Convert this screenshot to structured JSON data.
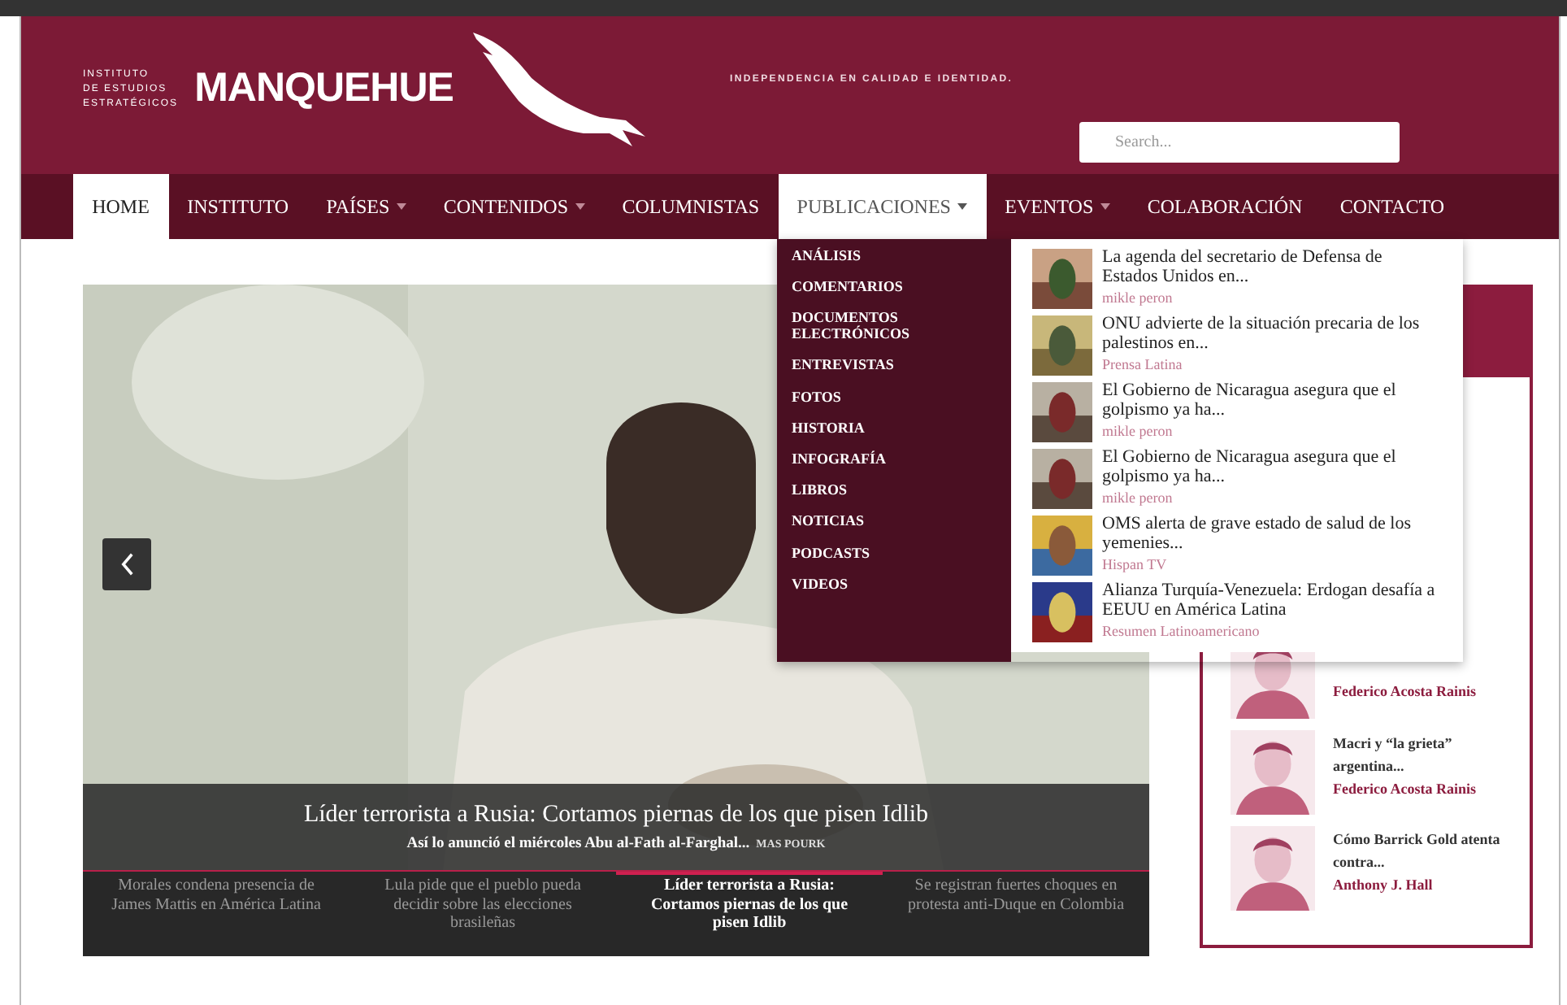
{
  "header": {
    "institute_lines": [
      "INSTITUTO",
      "DE ESTUDIOS",
      "ESTRATÉGICOS"
    ],
    "logo": "MANQUEHUE",
    "tagline": "INDEPENDENCIA EN CALIDAD E IDENTIDAD.",
    "search": {
      "placeholder": "Search..."
    }
  },
  "nav": [
    {
      "label": "HOME",
      "selected": true,
      "open": false,
      "dropdown": false
    },
    {
      "label": "INSTITUTO",
      "selected": false,
      "open": false,
      "dropdown": false
    },
    {
      "label": "PAÍSES",
      "selected": false,
      "open": false,
      "dropdown": true
    },
    {
      "label": "CONTENIDOS",
      "selected": false,
      "open": false,
      "dropdown": true
    },
    {
      "label": "COLUMNISTAS",
      "selected": false,
      "open": false,
      "dropdown": false
    },
    {
      "label": "PUBLICACIONES",
      "selected": false,
      "open": true,
      "dropdown": true
    },
    {
      "label": "EVENTOS",
      "selected": false,
      "open": false,
      "dropdown": true
    },
    {
      "label": "COLABORACIÓN",
      "selected": false,
      "open": false,
      "dropdown": false
    },
    {
      "label": "CONTACTO",
      "selected": false,
      "open": false,
      "dropdown": false
    }
  ],
  "dropdown": {
    "categories": [
      "ANÁLISIS",
      "COMENTARIOS",
      "DOCUMENTOS ELECTRÓNICOS",
      "ENTREVISTAS",
      "FOTOS",
      "HISTORIA",
      "INFOGRAFÍA",
      "LIBROS",
      "NOTICIAS",
      "PODCASTS",
      "VIDEOS"
    ],
    "news": [
      {
        "title": "La agenda del secretario de Defensa de Estados Unidos en...",
        "source": "mikle peron"
      },
      {
        "title": "ONU advierte de la situación precaria de los palestinos en...",
        "source": "Prensa Latina"
      },
      {
        "title": "El Gobierno de Nicaragua asegura que el golpismo ya ha...",
        "source": "mikle peron"
      },
      {
        "title": "El Gobierno de Nicaragua asegura que el golpismo ya ha...",
        "source": "mikle peron"
      },
      {
        "title": "OMS alerta de grave estado de salud de los yemenies...",
        "source": "Hispan TV"
      },
      {
        "title": "Alianza Turquía-Venezuela: Erdogan desafía a EEUU en América Latina",
        "source": "Resumen Latinoamericano"
      }
    ]
  },
  "slider": {
    "title": "Líder terrorista a Rusia: Cortamos piernas de los que pisen Idlib",
    "summary": "Así lo anunció el miércoles Abu al-Fath al-Farghal...",
    "more": "MAS POURK",
    "thumbs": [
      {
        "text": "Morales condena presencia de James Mattis en América Latina",
        "selected": false
      },
      {
        "text": "Lula pide que el pueblo pueda decidir sobre las elecciones brasileñas",
        "selected": false
      },
      {
        "text": "Líder terrorista a Rusia: Cortamos piernas de los que pisen Idlib",
        "selected": true
      },
      {
        "text": "Se registran fuertes choques en protesta anti-Duque en Colombia",
        "selected": false
      }
    ]
  },
  "sidebar": {
    "items": [
      {
        "author": "Federico Acosta Rainis"
      },
      {
        "title": "Macri y “la grieta” argentina...",
        "author": "Federico Acosta Rainis"
      },
      {
        "title": "Cómo Barrick Gold atenta contra...",
        "author": "Anthony J. Hall"
      }
    ]
  }
}
